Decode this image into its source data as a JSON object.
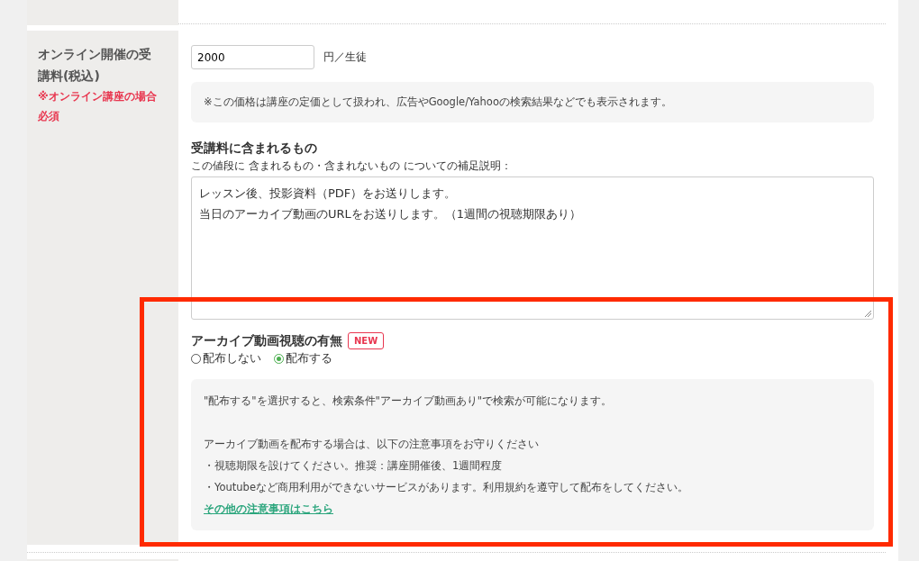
{
  "fee_row": {
    "label": "オンライン開催の受講料(税込)",
    "required_note": "※オンライン講座の場合必須",
    "price": {
      "value": "2000",
      "unit": "円／生徒"
    },
    "price_note": "※この価格は講座の定価として扱われ、広告やGoogle/Yahooの検索結果などでも表示されます。",
    "included": {
      "heading": "受講料に含まれるもの",
      "description": "この値段に 含まれるもの・含まれないもの についての補足説明：",
      "lines": [
        "レッスン後、投影資料（PDF）をお送りします。",
        "当日のアーカイブ動画のURLをお送りします。（1週間の視聴期限あり）"
      ]
    },
    "archive": {
      "heading": "アーカイブ動画視聴の有無",
      "badge": "NEW",
      "options": [
        {
          "label": "配布しない",
          "selected": false
        },
        {
          "label": "配布する",
          "selected": true
        }
      ],
      "info_intro": "\"配布する\"を選択すると、検索条件\"アーカイブ動画あり\"で検索が可能になります。",
      "info_lines": [
        "アーカイブ動画を配布する場合は、以下の注意事項をお守りください",
        "・視聴期限を設けてください。推奨：講座開催後、1週間程度",
        "・Youtubeなど商用利用ができないサービスがあります。利用規約を遵守して配布をしてください。"
      ],
      "link": "その他の注意事項はこちら"
    }
  }
}
